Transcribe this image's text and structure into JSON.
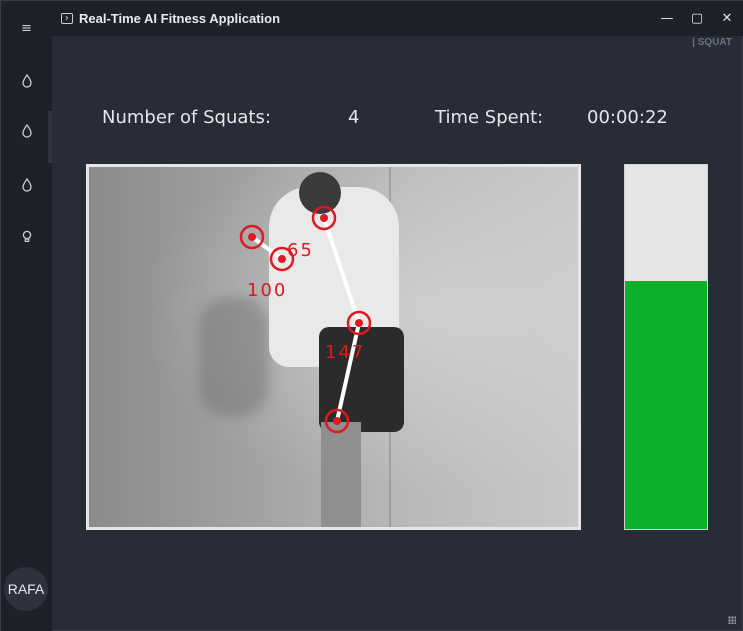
{
  "window": {
    "title": "Real-Time AI Fitness Application",
    "section_tag": "| SQUAT",
    "controls": {
      "minimize": "—",
      "maximize": "▢",
      "close": "✕"
    }
  },
  "sidebar": {
    "menu_icon": "≡",
    "items": [
      {
        "icon": "drop-icon",
        "glyph": "💧"
      },
      {
        "icon": "drop-icon",
        "glyph": "💧"
      },
      {
        "icon": "drop-icon",
        "glyph": "💧"
      },
      {
        "icon": "bulb-icon",
        "glyph": "💡"
      }
    ],
    "avatar_label": "RAFA"
  },
  "stats": {
    "squats_label": "Number of Squats:",
    "squats_value": "4",
    "time_label": "Time Spent:",
    "time_value": "00:00:22"
  },
  "pose": {
    "angles": [
      "65",
      "100",
      "147"
    ],
    "joint_color": "#e0181f",
    "bone_color": "#ffffff"
  },
  "progress": {
    "fill_fraction": 0.68,
    "fill_color": "#0ab22a",
    "empty_color": "#e6e6e6"
  }
}
